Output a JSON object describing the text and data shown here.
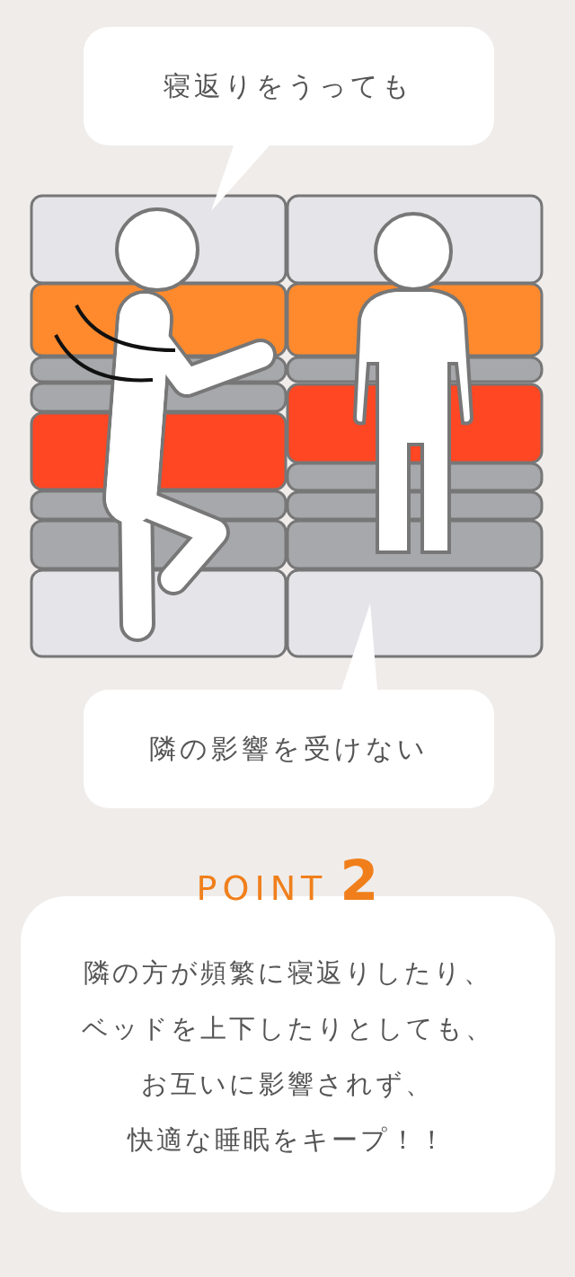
{
  "top_bubble": {
    "text": "寝返りをうっても"
  },
  "bottom_bubble": {
    "text": "隣の影響を受けない"
  },
  "point": {
    "label": "POINT",
    "number": "2"
  },
  "card": {
    "lines": [
      "隣の方が頻繁に寝返りしたり、",
      "ベッドを上下したりとしても、",
      "お互いに影響されず、",
      "快適な睡眠をキープ！！"
    ]
  }
}
